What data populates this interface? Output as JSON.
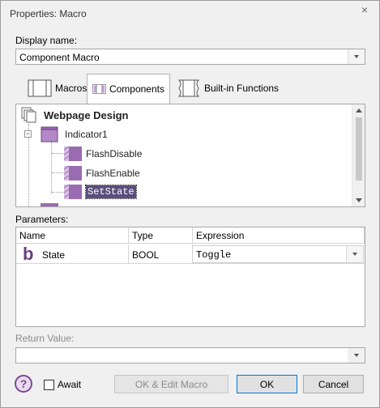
{
  "window": {
    "title": "Properties: Macro",
    "close_glyph": "×"
  },
  "display_name": {
    "label": "Display name:",
    "value": "Component Macro"
  },
  "tabs": [
    {
      "label": "Macros",
      "icon": "macro-icon"
    },
    {
      "label": "Components",
      "icon": "component-icon"
    },
    {
      "label": "Built-in Functions",
      "icon": "builtin-functions-icon"
    }
  ],
  "tree": {
    "root": "Webpage Design",
    "group": "Indicator1",
    "items": [
      "FlashDisable",
      "FlashEnable",
      "SetState"
    ],
    "selected": "SetState"
  },
  "parameters": {
    "label": "Parameters:",
    "columns": [
      "Name",
      "Type",
      "Expression"
    ],
    "rows": [
      {
        "name": "State",
        "type": "BOOL",
        "expression": "Toggle"
      }
    ]
  },
  "return_value": {
    "label": "Return Value:",
    "value": ""
  },
  "footer": {
    "await_label": "Await",
    "ok_edit_label": "OK & Edit Macro",
    "ok_label": "OK",
    "cancel_label": "Cancel"
  },
  "colors": {
    "accent": "#0078d7",
    "icon_purple": "#8c5aa6",
    "selection": "#5a4f7c"
  }
}
